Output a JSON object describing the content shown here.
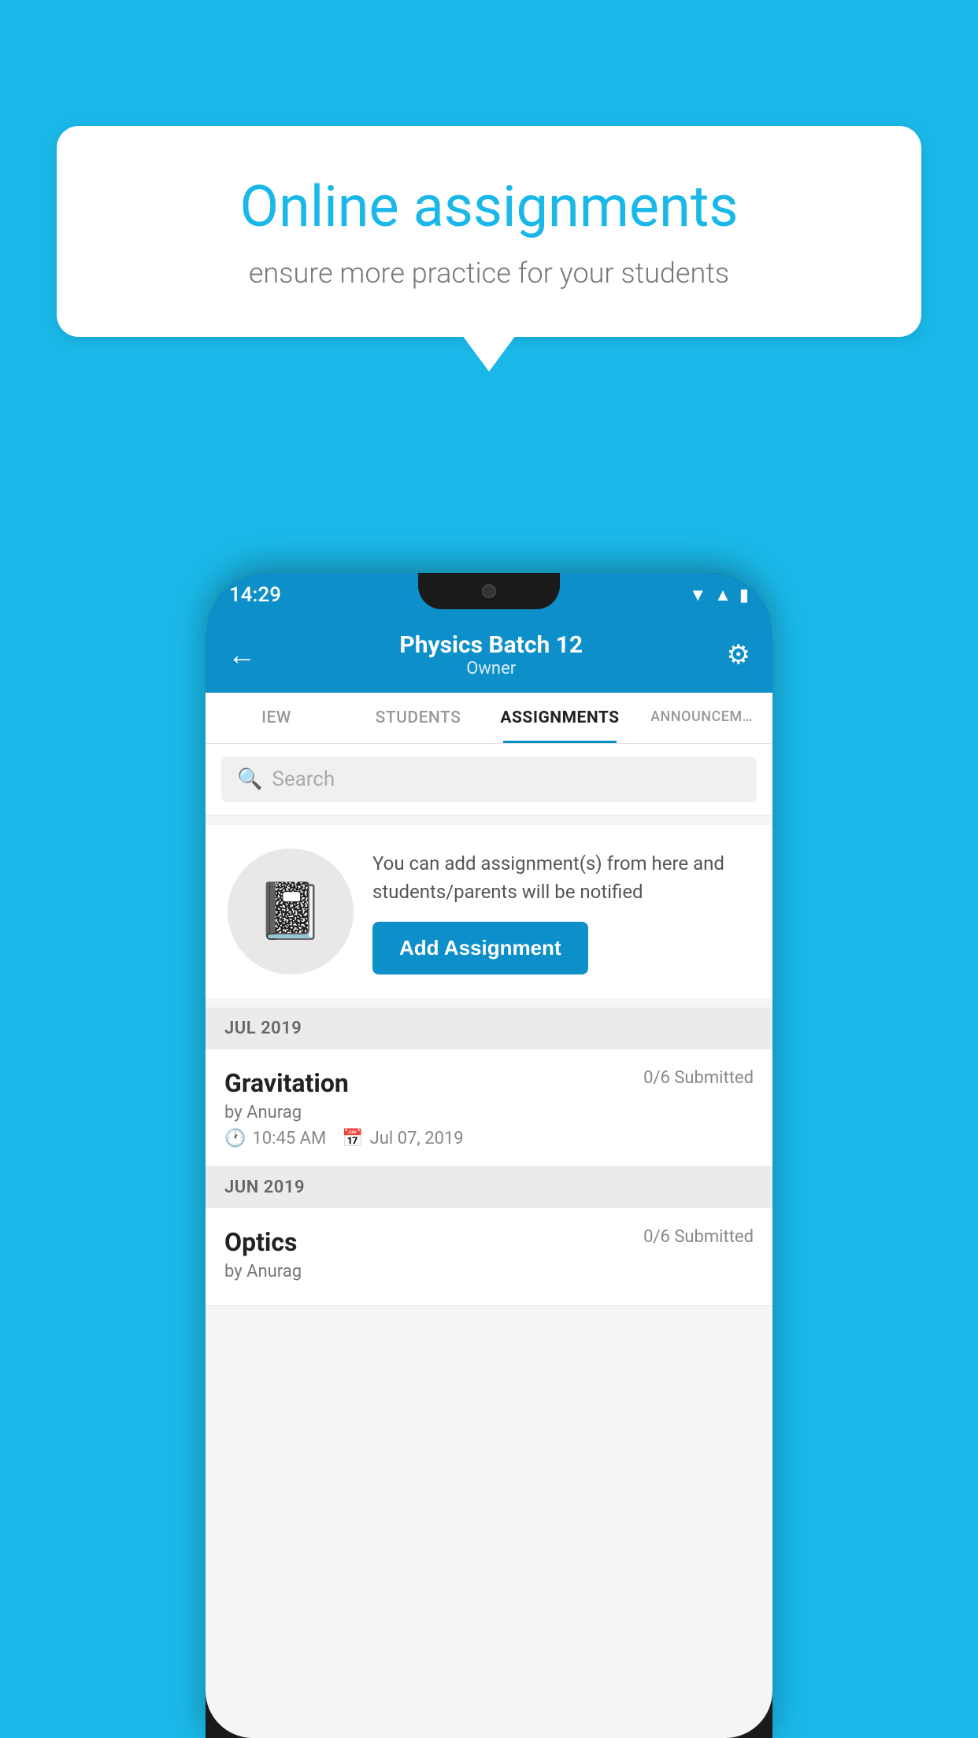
{
  "background_color": "#1ab8e8",
  "speech_bubble": {
    "title": "Online assignments",
    "subtitle": "ensure more practice for your students"
  },
  "phone": {
    "status_bar": {
      "time": "14:29",
      "wifi_icon": "▲",
      "signal_icon": "◀",
      "battery_icon": "▮"
    },
    "header": {
      "title": "Physics Batch 12",
      "subtitle": "Owner",
      "back_label": "←",
      "settings_label": "⚙"
    },
    "tabs": [
      {
        "label": "IEW",
        "active": false
      },
      {
        "label": "STUDENTS",
        "active": false
      },
      {
        "label": "ASSIGNMENTS",
        "active": true
      },
      {
        "label": "ANNOUNCEM…",
        "active": false
      }
    ],
    "search": {
      "placeholder": "Search"
    },
    "promo": {
      "description": "You can add assignment(s) from here and students/parents will be notified",
      "button_label": "Add Assignment"
    },
    "sections": [
      {
        "label": "JUL 2019",
        "assignments": [
          {
            "name": "Gravitation",
            "submitted": "0/6 Submitted",
            "by": "by Anurag",
            "time": "10:45 AM",
            "date": "Jul 07, 2019"
          }
        ]
      },
      {
        "label": "JUN 2019",
        "assignments": [
          {
            "name": "Optics",
            "submitted": "0/6 Submitted",
            "by": "by Anurag",
            "time": "",
            "date": ""
          }
        ]
      }
    ]
  }
}
